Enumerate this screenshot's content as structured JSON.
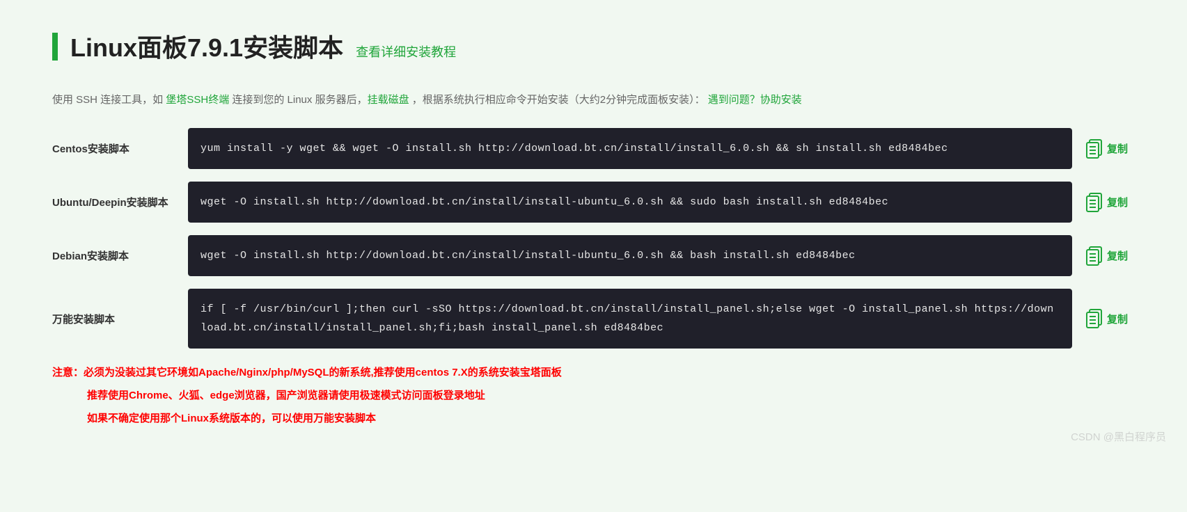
{
  "header": {
    "title": "Linux面板7.9.1安装脚本",
    "tutorial_link": "查看详细安装教程"
  },
  "intro": {
    "t1": "使用 SSH 连接工具，如 ",
    "link1": "堡塔SSH终端",
    "t2": " 连接到您的 Linux 服务器后，",
    "link2": "挂载磁盘",
    "t3": " ，根据系统执行相应命令开始安装（大约2分钟完成面板安装）：",
    "link3": "遇到问题？协助安装"
  },
  "copy_label": "复制",
  "scripts": [
    {
      "label": "Centos安装脚本",
      "code": "yum install -y wget && wget -O install.sh http://download.bt.cn/install/install_6.0.sh && sh install.sh ed8484bec"
    },
    {
      "label": "Ubuntu/Deepin安装脚本",
      "code": "wget -O install.sh http://download.bt.cn/install/install-ubuntu_6.0.sh && sudo bash install.sh ed8484bec"
    },
    {
      "label": "Debian安装脚本",
      "code": "wget -O install.sh http://download.bt.cn/install/install-ubuntu_6.0.sh && bash install.sh ed8484bec"
    },
    {
      "label": "万能安装脚本",
      "code": "if [ -f /usr/bin/curl ];then curl -sSO https://download.bt.cn/install/install_panel.sh;else wget -O install_panel.sh https://download.bt.cn/install/install_panel.sh;fi;bash install_panel.sh ed8484bec"
    }
  ],
  "notes": {
    "line1": "注意：必须为没装过其它环境如Apache/Nginx/php/MySQL的新系统,推荐使用centos 7.X的系统安装宝塔面板",
    "line2": "推荐使用Chrome、火狐、edge浏览器，国产浏览器请使用极速模式访问面板登录地址",
    "line3": "如果不确定使用那个Linux系统版本的，可以使用万能安装脚本"
  },
  "watermark": "CSDN @黑白程序员"
}
